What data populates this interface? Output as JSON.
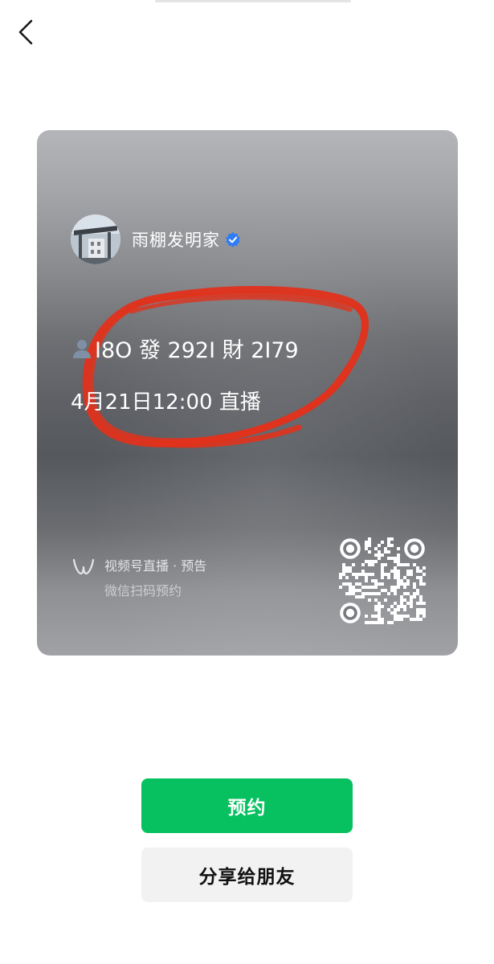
{
  "header": {
    "back_icon": "chevron-left-icon"
  },
  "poster": {
    "author": {
      "name": "雨棚发明家",
      "verified_icon": "verified-badge-icon",
      "avatar_icon": "building-photo-avatar"
    },
    "live": {
      "title": "I8O 發 292I 財 2I79",
      "title_icon": "person-silhouette-icon",
      "time": "4月21日12:00 直播"
    },
    "channel": {
      "logo_icon": "channels-logo-icon",
      "label": "视频号直播 · 预告",
      "hint": "微信扫码预约"
    },
    "qr_icon": "qr-code-icon",
    "annotation_color": "#e0321c"
  },
  "actions": {
    "reserve_label": "预约",
    "share_label": "分享给朋友"
  },
  "colors": {
    "accent": "#07c160",
    "secondary_button": "#f2f2f2"
  }
}
